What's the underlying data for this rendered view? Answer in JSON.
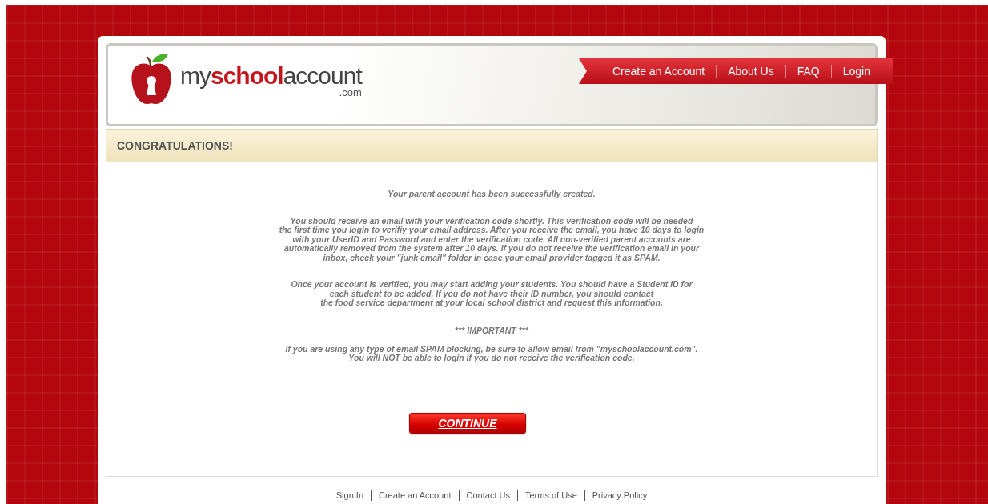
{
  "logo": {
    "name": "my**school**account",
    "suffix": ".com"
  },
  "nav": [
    "Create an Account",
    "About Us",
    "FAQ",
    "Login"
  ],
  "title": "CONGRATULATIONS!",
  "paragraphs": [
    {
      "lines": [
        "Your parent account has been successfully created."
      ]
    },
    {
      "lines": [
        "You should receive an email with your verification code shortly. This verification code will be needed",
        "the first time you login to verifiy your email address.  After you receive the email, you have 10 days to login",
        "with your UserID and Password and enter the verification code. All non-verified parent accounts are",
        "automatically removed from the system after 10 days. If you do not receive the verification email in your",
        "inbox, check your \"junk email\" folder in case your email provider tagged it as SPAM."
      ]
    },
    {
      "lines": [
        "Once your account is verified, you may start adding your students. You should have a Student ID for",
        "each student to be added. If you do not have their ID number, you should contact",
        "the food service department at your local school district and request this information."
      ]
    }
  ],
  "important": {
    "heading": "*** IMPORTANT ***",
    "lines": [
      "If you are using any type of email SPAM blocking, be sure to allow email from \"myschoolaccount.com\".",
      "You will NOT be able to login if you do not receive the verification code."
    ]
  },
  "continue_button": "CONTINUE",
  "footer_links": [
    "Sign In",
    "Create an Account",
    "Contact Us",
    "Terms of Use",
    "Privacy Policy"
  ]
}
